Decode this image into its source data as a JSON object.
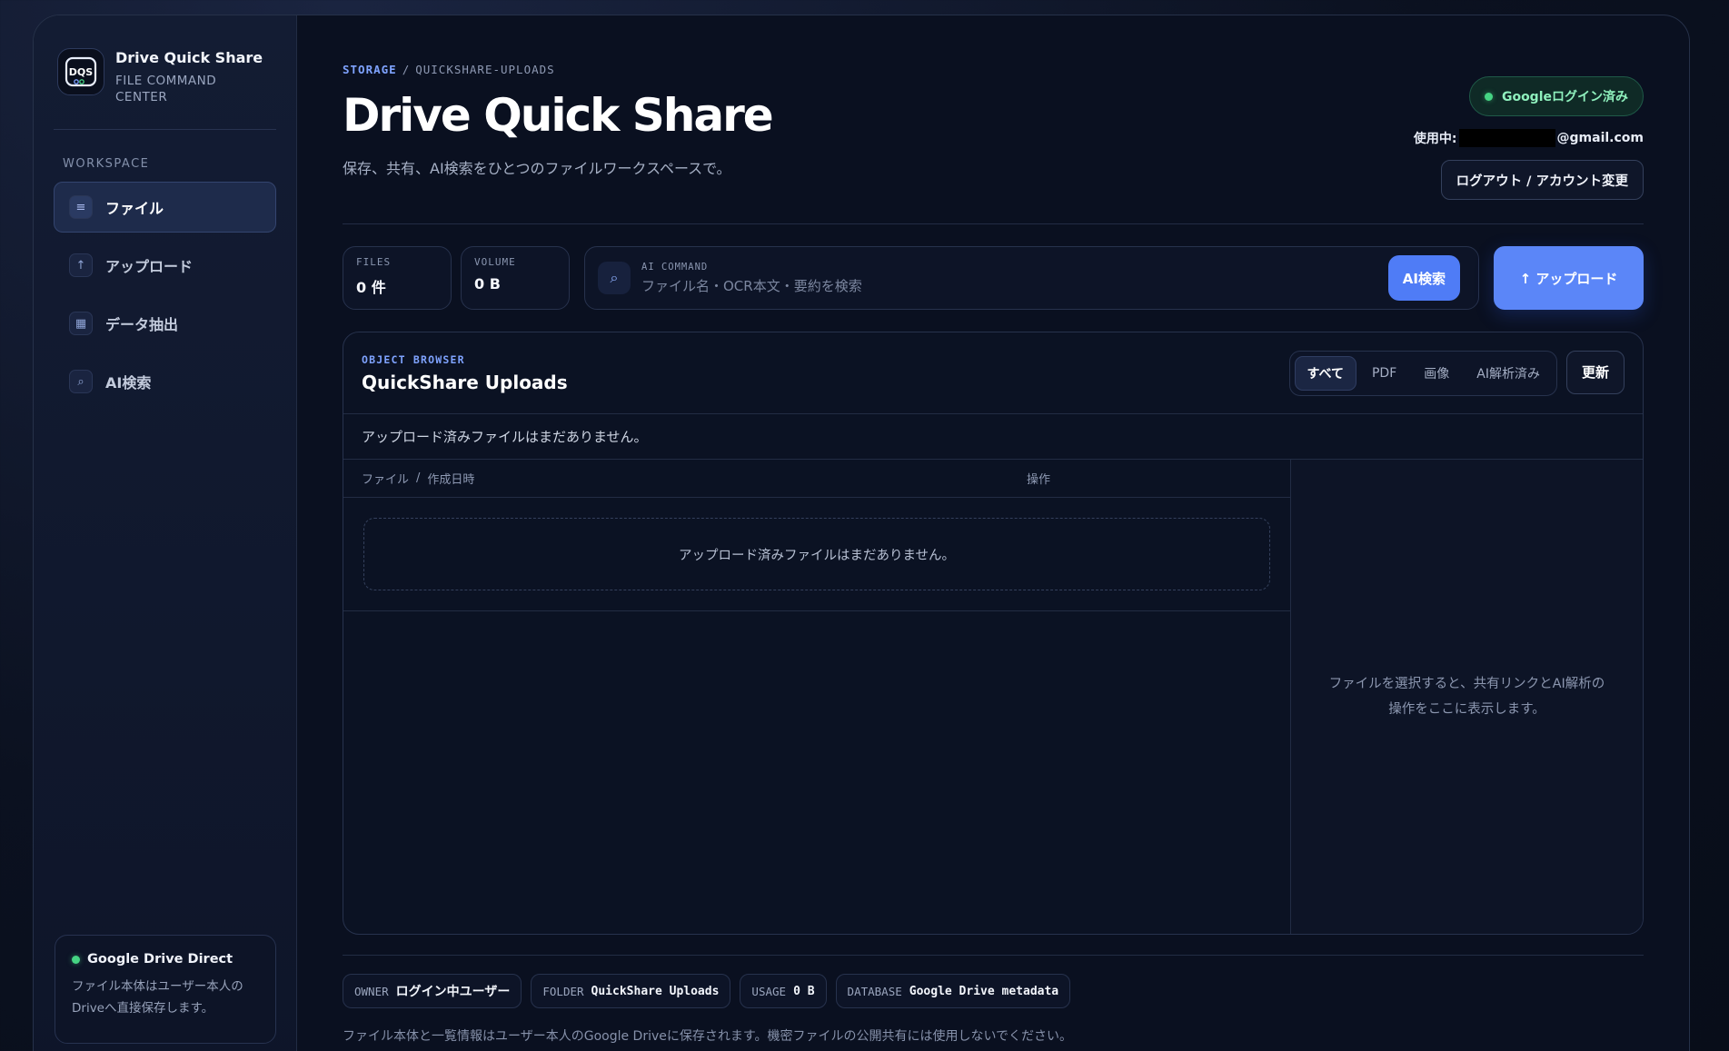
{
  "brand": {
    "logo_text": "DQS",
    "title": "Drive Quick Share",
    "subtitle": "FILE COMMAND CENTER"
  },
  "sidebar": {
    "section_label": "WORKSPACE",
    "items": [
      {
        "label": "ファイル",
        "icon": "list-icon",
        "glyph": "≡",
        "active": true
      },
      {
        "label": "アップロード",
        "icon": "upload-arrow-icon",
        "glyph": "↑",
        "active": false
      },
      {
        "label": "データ抽出",
        "icon": "grid-icon",
        "glyph": "▦",
        "active": false
      },
      {
        "label": "AI検索",
        "icon": "search-icon",
        "glyph": "⌕",
        "active": false
      }
    ],
    "drive_card": {
      "title": "Google Drive Direct",
      "description": "ファイル本体はユーザー本人のDriveへ直接保存します。"
    }
  },
  "header": {
    "breadcrumb": [
      "STORAGE",
      "QUICKSHARE-UPLOADS"
    ],
    "breadcrumb_sep": "/",
    "title": "Drive Quick Share",
    "description": "保存、共有、AI検索をひとつのファイルワークスペースで。",
    "login_badge": "Googleログイン済み",
    "user_prefix": "使用中:",
    "user_email_suffix": "@gmail.com",
    "logout_label": "ログアウト / アカウント変更"
  },
  "stats": {
    "files_label": "FILES",
    "files_value": "0 件",
    "volume_label": "VOLUME",
    "volume_value": "0 B"
  },
  "search": {
    "label": "AI COMMAND",
    "placeholder": "ファイル名・OCR本文・要約を検索",
    "value": "",
    "button_label": "AI検索"
  },
  "upload_button": "↑ アップロード",
  "browser": {
    "label": "OBJECT BROWSER",
    "title": "QuickShare Uploads",
    "filters": [
      "すべて",
      "PDF",
      "画像",
      "AI解析済み"
    ],
    "active_filter": "すべて",
    "refresh_label": "更新",
    "notice": "アップロード済みファイルはまだありません。",
    "columns": {
      "file": "ファイル",
      "sep": "/",
      "created": "作成日時",
      "actions": "操作"
    },
    "empty_message": "アップロード済みファイルはまだありません。",
    "detail_hint": "ファイルを選択すると、共有リンクとAI解析の操作をここに表示します。"
  },
  "chips": [
    {
      "key": "OWNER",
      "value": "ログイン中ユーザー",
      "mono": false
    },
    {
      "key": "FOLDER",
      "value": "QuickShare Uploads",
      "mono": true
    },
    {
      "key": "USAGE",
      "value": "0 B",
      "mono": true
    },
    {
      "key": "DATABASE",
      "value": "Google Drive metadata",
      "mono": true
    }
  ],
  "footnote": "ファイル本体と一覧情報はユーザー本人のGoogle Driveに保存されます。機密ファイルの公開共有には使用しないでください。",
  "colors": {
    "accent": "#5b86f8",
    "success": "#45d483",
    "background": "#0a1020"
  }
}
